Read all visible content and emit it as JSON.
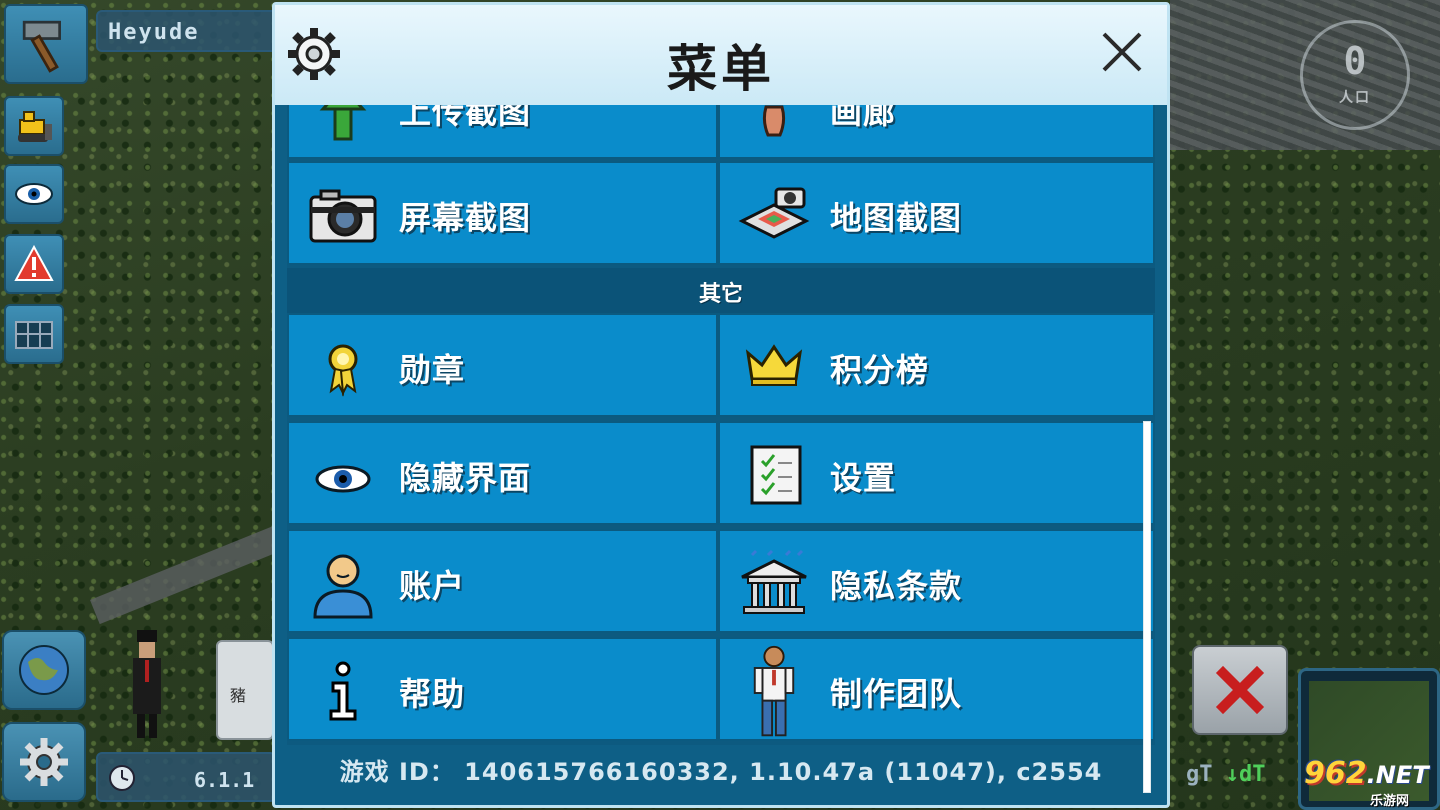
{
  "hud": {
    "city_name": "Heyude",
    "version": "6.1.1",
    "counter_value": "0",
    "counter_sub": "人口",
    "dt_label": "gT",
    "dt_green": "↓dT",
    "bubble_text": "豬"
  },
  "menu": {
    "title": "菜单",
    "rows_top_partial": [
      {
        "label": "上传截图",
        "icon": "upload-icon"
      },
      {
        "label": "画廊",
        "icon": "vase-icon"
      }
    ],
    "rows_capture": [
      {
        "label": "屏幕截图",
        "icon": "camera-icon"
      },
      {
        "label": "地图截图",
        "icon": "map-camera-icon"
      }
    ],
    "section_other": "其它",
    "rows_other": [
      [
        {
          "label": "勋章",
          "icon": "medal-icon"
        },
        {
          "label": "积分榜",
          "icon": "crown-icon"
        }
      ],
      [
        {
          "label": "隐藏界面",
          "icon": "eye-icon"
        },
        {
          "label": "设置",
          "icon": "checklist-icon"
        }
      ],
      [
        {
          "label": "账户",
          "icon": "user-icon"
        },
        {
          "label": "隐私条款",
          "icon": "bank-building-icon"
        }
      ],
      [
        {
          "label": "帮助",
          "icon": "info-icon"
        },
        {
          "label": "制作团队",
          "icon": "person-icon"
        }
      ]
    ],
    "footer": "游戏 ID： 140615766160332, 1.10.47a (11047), c2554"
  },
  "watermark": {
    "main": "962",
    "net": ".NET",
    "sub": "乐游网"
  },
  "colors": {
    "cell_bg": "#0a8ccb",
    "dialog_bg": "#0e5f86",
    "header_bg": "#e9f7fd",
    "accent_red": "#c0392b"
  }
}
